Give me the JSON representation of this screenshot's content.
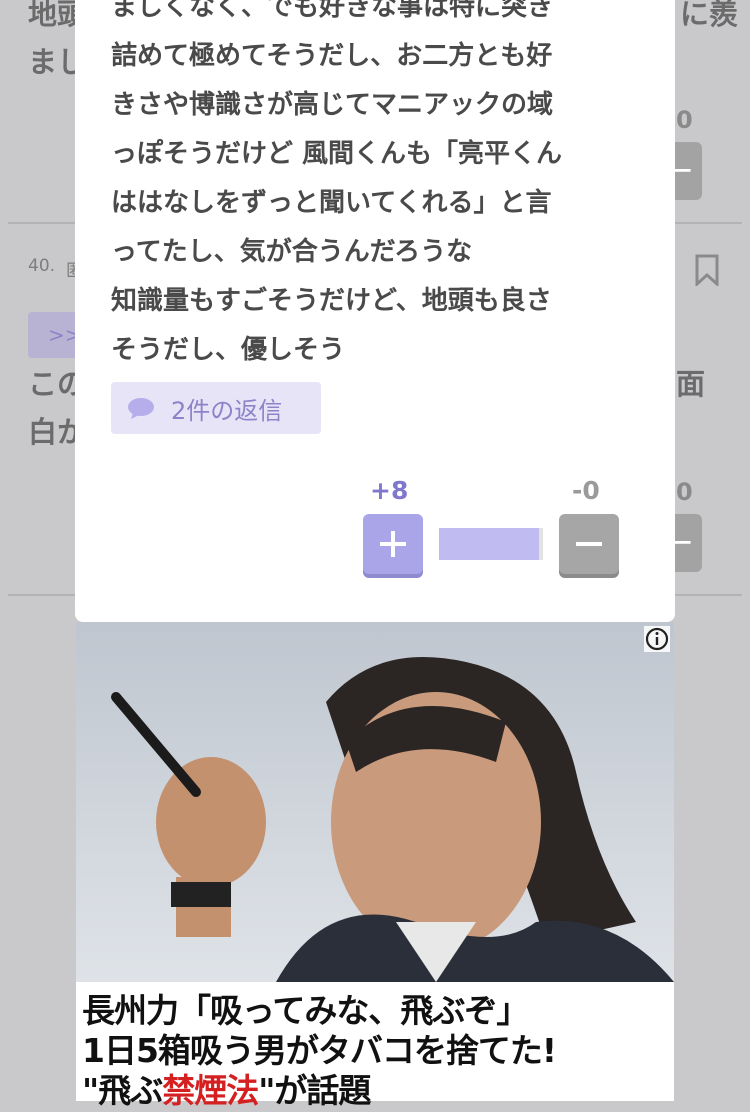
{
  "background_post": {
    "top_lines": [
      "地頭",
      "まし",
      "に羨"
    ],
    "comment_number": "40.",
    "meta_char": "匿",
    "quote_ref": ">>",
    "body_lines": [
      "この",
      "白か",
      "面"
    ],
    "vote_count_plus_partial": "0",
    "vote_count_minus_partial": "0",
    "minus_label": "−"
  },
  "modal": {
    "body": "ましくなく、でも好きな事は特に突き\n詰めて極めてそうだし、お二方とも好\nきさや博識さが高じてマニアックの域\nっぽそうだけど 風間くんも「亮平くん\nははなしをずっと聞いてくれる」と言\nってたし、気が合うんだろうな\n知識量もすごそうだけど、地頭も良さ\nそうだし、優しそう",
    "replies_label": "2件の返信",
    "plus_count": "+8",
    "minus_count": "-0",
    "plus_fraction": 1.0,
    "colors": {
      "accent": "#8077cf",
      "plus_button": "#aaa4e8",
      "minus_button": "#a6a6a6",
      "reply_bg": "#e8e4f8"
    }
  },
  "ad": {
    "icons": [
      "info-icon",
      "cigarette-man-photo"
    ],
    "caption_line1": "長州力「吸ってみな、飛ぶぞ」",
    "caption_line2": "1日5箱吸う男がタバコを捨てた!",
    "caption_line3_a": "\"飛ぶ",
    "caption_line3_red": "禁煙法",
    "caption_line3_b": "\"が話題"
  }
}
